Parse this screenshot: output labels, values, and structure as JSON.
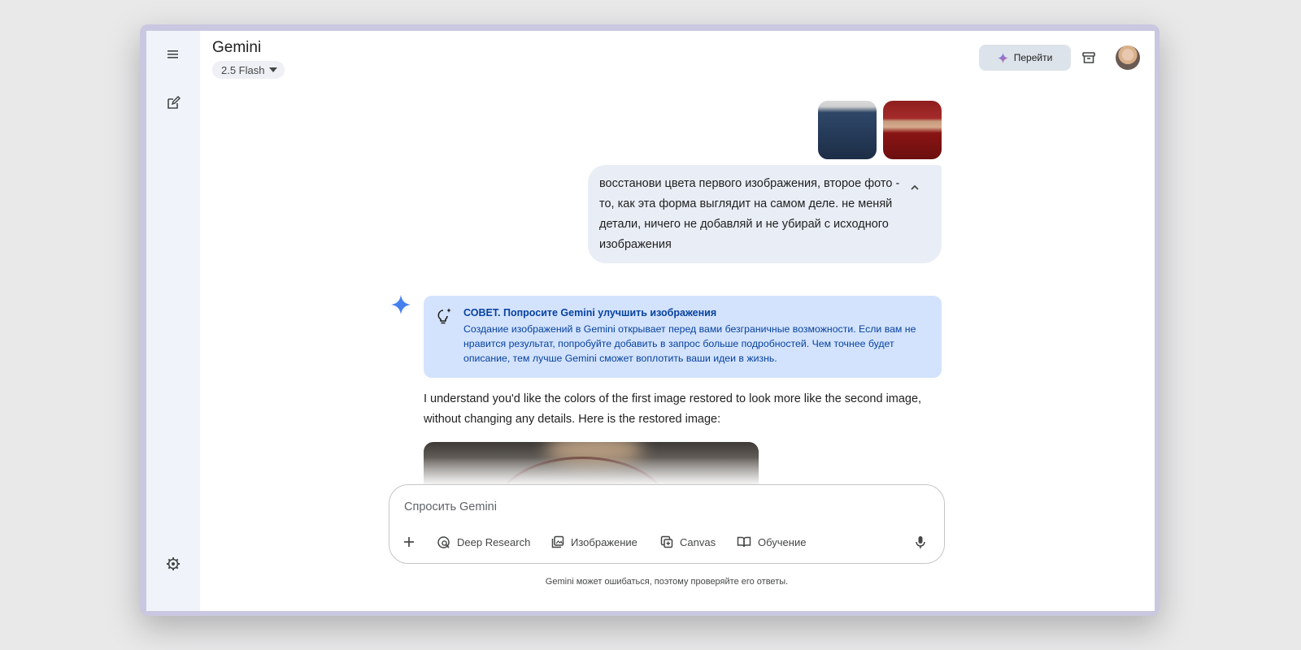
{
  "app": {
    "title": "Gemini",
    "model": "2.5 Flash"
  },
  "header": {
    "upgrade_label": "Перейти"
  },
  "conversation": {
    "user_message": "восстанови цвета первого изображения, второе фото - то, как эта форма выглядит на самом деле. не меняй детали, ничего не добавляй и не убирай с исходного изображения",
    "tip_title": "СОВЕТ. Попросите Gemini улучшить изображения",
    "tip_body": "Создание изображений в Gemini открывает перед вами безграничные возможности. Если вам не нравится результат, попробуйте добавить в запрос больше подробностей. Чем точнее будет описание, тем лучше Gemini сможет воплотить ваши идеи в жизнь.",
    "response": "I understand you'd like the colors of the first image restored to look more like the second image, without changing any details. Here is the restored image:"
  },
  "composer": {
    "placeholder": "Спросить Gemini",
    "tools": [
      {
        "label": "Deep Research",
        "icon": "deep-research-icon"
      },
      {
        "label": "Изображение",
        "icon": "image-gen-icon"
      },
      {
        "label": "Canvas",
        "icon": "canvas-icon"
      },
      {
        "label": "Обучение",
        "icon": "book-icon"
      }
    ]
  },
  "footer": {
    "disclaimer": "Gemini может ошибаться, поэтому проверяйте его ответы."
  },
  "colors": {
    "accent": "#0842a0",
    "tip_background": "#d3e3fd",
    "user_bubble": "#e9eef6",
    "sidebar": "#f0f3fa"
  }
}
